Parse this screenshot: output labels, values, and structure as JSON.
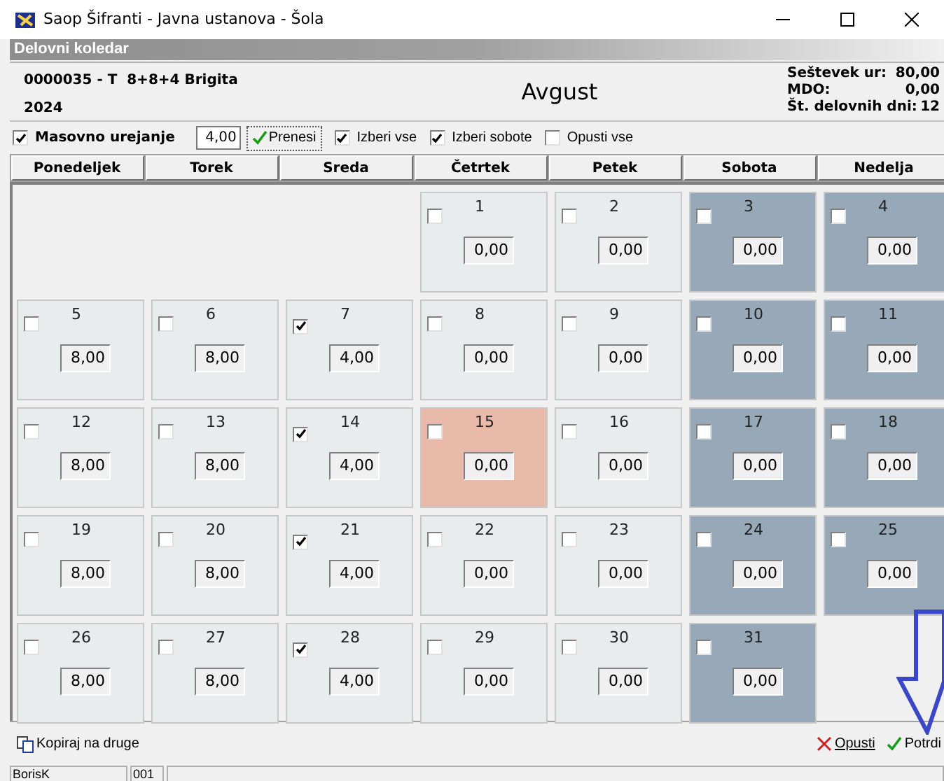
{
  "window": {
    "title": "Saop Šifranti - Javna ustanova - Šola"
  },
  "panel_title": "Delovni koledar",
  "header": {
    "employee": "0000035 - T  8+8+4 Brigita",
    "year": "2024",
    "month": "Avgust",
    "totals": [
      {
        "label": "Seštevek ur:",
        "value": "80,00"
      },
      {
        "label": "MDO:",
        "value": "0,00"
      },
      {
        "label": "Št. delovnih dni:",
        "value": "12"
      }
    ]
  },
  "toolbar": {
    "mass_edit": {
      "label": "Masovno urejanje",
      "checked": true
    },
    "hours": "4,00",
    "apply_button": "Prenesi",
    "options": [
      {
        "label": "Izberi vse",
        "checked": true
      },
      {
        "label": "Izberi sobote",
        "checked": true
      },
      {
        "label": "Opusti vse",
        "checked": false
      }
    ]
  },
  "weekdays": [
    "Ponedeljek",
    "Torek",
    "Sreda",
    "Četrtek",
    "Petek",
    "Sobota",
    "Nedelja"
  ],
  "weeks": [
    [
      {
        "kind": "empty"
      },
      {
        "kind": "empty"
      },
      {
        "kind": "empty"
      },
      {
        "kind": "workday",
        "day": "1",
        "checked": false,
        "hours": "0,00"
      },
      {
        "kind": "workday",
        "day": "2",
        "checked": false,
        "hours": "0,00"
      },
      {
        "kind": "weekend",
        "day": "3",
        "checked": false,
        "hours": "0,00"
      },
      {
        "kind": "weekend",
        "day": "4",
        "checked": false,
        "hours": "0,00"
      }
    ],
    [
      {
        "kind": "workday",
        "day": "5",
        "checked": false,
        "hours": "8,00"
      },
      {
        "kind": "workday",
        "day": "6",
        "checked": false,
        "hours": "8,00"
      },
      {
        "kind": "workday",
        "day": "7",
        "checked": true,
        "hours": "4,00"
      },
      {
        "kind": "workday",
        "day": "8",
        "checked": false,
        "hours": "0,00"
      },
      {
        "kind": "workday",
        "day": "9",
        "checked": false,
        "hours": "0,00"
      },
      {
        "kind": "weekend",
        "day": "10",
        "checked": false,
        "hours": "0,00"
      },
      {
        "kind": "weekend",
        "day": "11",
        "checked": false,
        "hours": "0,00"
      }
    ],
    [
      {
        "kind": "workday",
        "day": "12",
        "checked": false,
        "hours": "8,00"
      },
      {
        "kind": "workday",
        "day": "13",
        "checked": false,
        "hours": "8,00"
      },
      {
        "kind": "workday",
        "day": "14",
        "checked": true,
        "hours": "4,00"
      },
      {
        "kind": "holiday",
        "day": "15",
        "checked": false,
        "hours": "0,00"
      },
      {
        "kind": "workday",
        "day": "16",
        "checked": false,
        "hours": "0,00"
      },
      {
        "kind": "weekend",
        "day": "17",
        "checked": false,
        "hours": "0,00"
      },
      {
        "kind": "weekend",
        "day": "18",
        "checked": false,
        "hours": "0,00"
      }
    ],
    [
      {
        "kind": "workday",
        "day": "19",
        "checked": false,
        "hours": "8,00"
      },
      {
        "kind": "workday",
        "day": "20",
        "checked": false,
        "hours": "8,00"
      },
      {
        "kind": "workday",
        "day": "21",
        "checked": true,
        "hours": "4,00"
      },
      {
        "kind": "workday",
        "day": "22",
        "checked": false,
        "hours": "0,00"
      },
      {
        "kind": "workday",
        "day": "23",
        "checked": false,
        "hours": "0,00"
      },
      {
        "kind": "weekend",
        "day": "24",
        "checked": false,
        "hours": "0,00"
      },
      {
        "kind": "weekend",
        "day": "25",
        "checked": false,
        "hours": "0,00"
      }
    ],
    [
      {
        "kind": "workday",
        "day": "26",
        "checked": false,
        "hours": "8,00"
      },
      {
        "kind": "workday",
        "day": "27",
        "checked": false,
        "hours": "8,00"
      },
      {
        "kind": "workday",
        "day": "28",
        "checked": true,
        "hours": "4,00"
      },
      {
        "kind": "workday",
        "day": "29",
        "checked": false,
        "hours": "0,00"
      },
      {
        "kind": "workday",
        "day": "30",
        "checked": false,
        "hours": "0,00"
      },
      {
        "kind": "weekend",
        "day": "31",
        "checked": false,
        "hours": "0,00"
      },
      {
        "kind": "empty"
      }
    ]
  ],
  "footer": {
    "copy_button": "Kopiraj na druge",
    "cancel_button": "Opusti",
    "confirm_button": "Potrdi"
  },
  "status_bar": [
    "BorisK",
    "001"
  ]
}
